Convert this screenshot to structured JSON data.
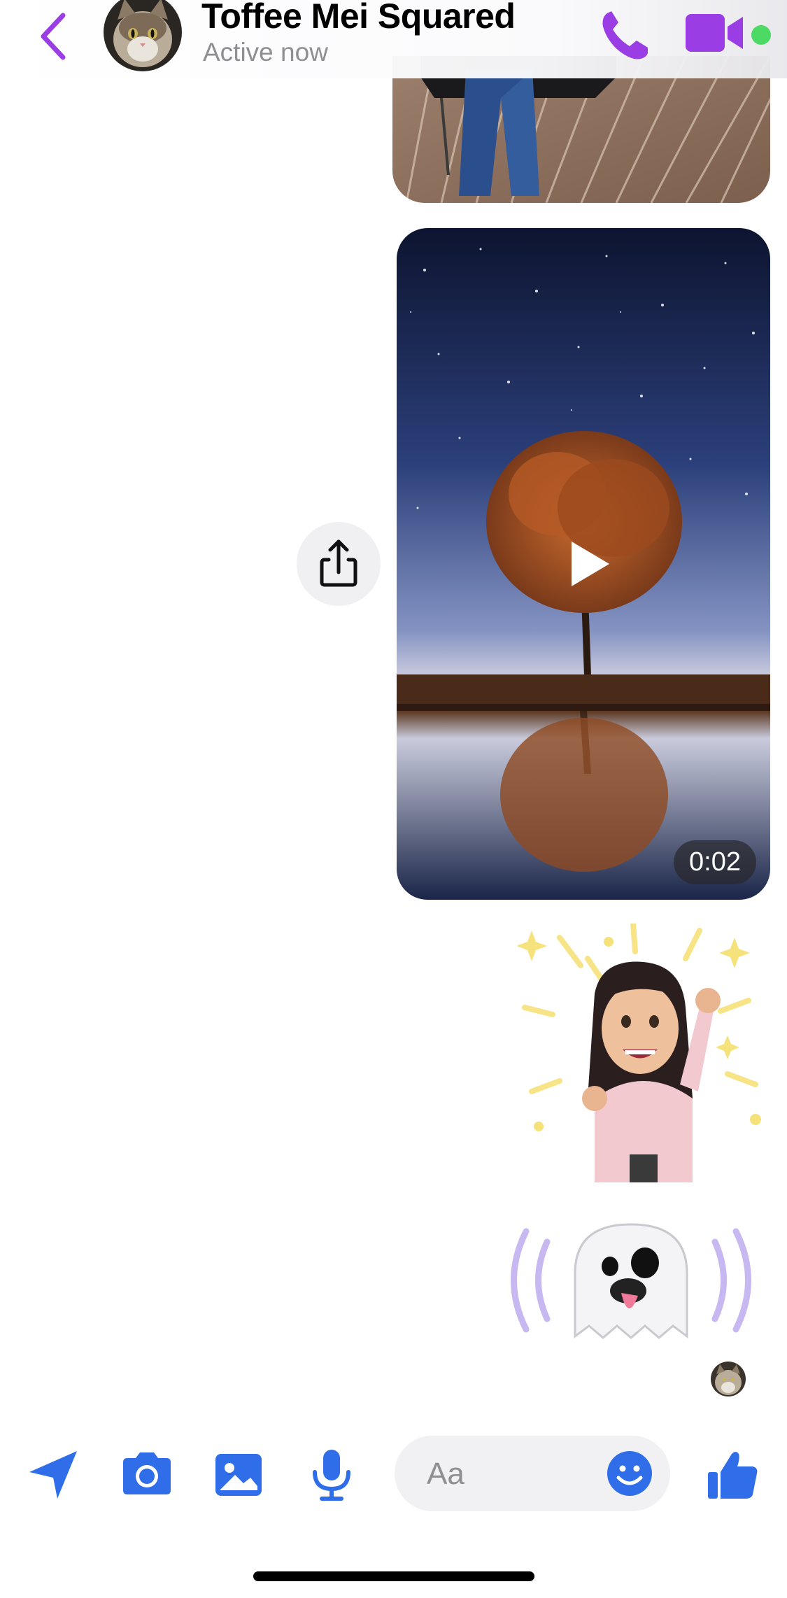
{
  "header": {
    "contact_name": "Toffee Mei Squared",
    "status": "Active now",
    "accent_color": "#9b3de4",
    "online_color": "#4cd964"
  },
  "messages": {
    "video": {
      "duration": "0:02"
    }
  },
  "composer": {
    "placeholder": "Aa",
    "accent_color": "#2f6ee8"
  },
  "icons": [
    "back-chevron-icon",
    "phone-icon",
    "video-camera-icon",
    "share-icon",
    "play-icon",
    "location-arrow-icon",
    "camera-icon",
    "image-icon",
    "microphone-icon",
    "smiley-icon",
    "thumbs-up-icon"
  ]
}
